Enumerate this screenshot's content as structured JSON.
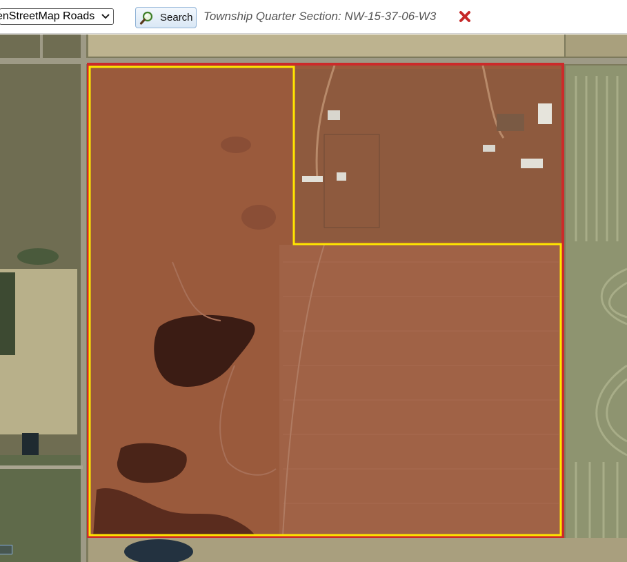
{
  "toolbar": {
    "layer_select": {
      "value": "OpenStreetMap Roads",
      "visible_text": "enStreetMap Roads"
    },
    "search_button": {
      "label": "Search",
      "icon": "magnifier-icon"
    },
    "section_label": "Township Quarter Section: NW-15-37-06-W3",
    "clear_icon": "close-icon"
  },
  "map": {
    "basemap": "satellite-imagery",
    "parcel_outline_color": "#cc2a2a",
    "selection_outline_color": "#ffe600"
  },
  "colors": {
    "accent_red": "#cc2a2a",
    "highlight_yellow": "#ffe600"
  }
}
